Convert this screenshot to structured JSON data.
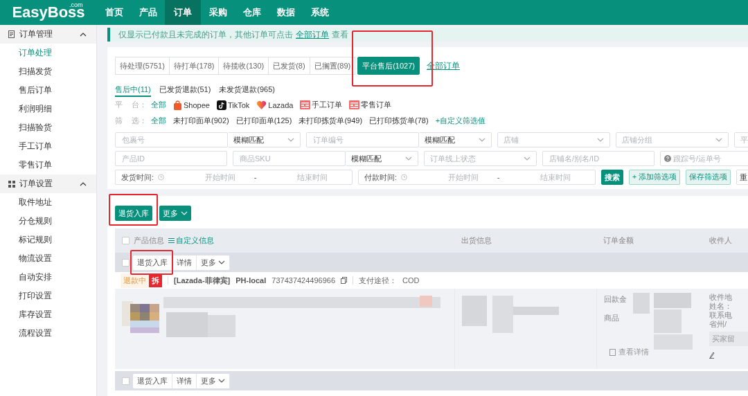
{
  "top_nav": {
    "logo": "EasyBoss",
    "logo_suffix": ".com",
    "items": [
      {
        "label": "首页",
        "selected": false
      },
      {
        "label": "产品",
        "selected": false
      },
      {
        "label": "订单",
        "selected": true
      },
      {
        "label": "采购",
        "selected": false
      },
      {
        "label": "仓库",
        "selected": false
      },
      {
        "label": "数据",
        "selected": false
      },
      {
        "label": "系统",
        "selected": false
      }
    ]
  },
  "sidebar": {
    "groups": [
      {
        "label": "订单管理",
        "kind": "doc",
        "expanded": true,
        "items": [
          {
            "label": "订单处理",
            "selected": true
          },
          {
            "label": "扫描发货",
            "selected": false
          },
          {
            "label": "售后订单",
            "selected": false
          },
          {
            "label": "利润明细",
            "selected": false
          },
          {
            "label": "扫描验货",
            "selected": false
          },
          {
            "label": "手工订单",
            "selected": false
          },
          {
            "label": "零售订单",
            "selected": false
          }
        ]
      },
      {
        "label": "订单设置",
        "kind": "grid",
        "expanded": true,
        "items": [
          {
            "label": "取件地址",
            "selected": false
          },
          {
            "label": "分仓规则",
            "selected": false
          },
          {
            "label": "标记规则",
            "selected": false
          },
          {
            "label": "物流设置",
            "selected": false
          },
          {
            "label": "自动安排",
            "selected": false
          },
          {
            "label": "打印设置",
            "selected": false
          },
          {
            "label": "库存设置",
            "selected": false
          },
          {
            "label": "流程设置",
            "selected": false
          }
        ]
      }
    ]
  },
  "notice": {
    "text": "仅显示已付款且未完成的订单，其他订单可点击",
    "link": "全部订单",
    "suffix": "查看"
  },
  "status_tabs": [
    {
      "label": "待处理(5751)",
      "selected": false,
      "highlighted": false
    },
    {
      "label": "待打单(178)",
      "selected": false,
      "highlighted": false
    },
    {
      "label": "待揽收(130)",
      "selected": false,
      "highlighted": false
    },
    {
      "label": "已发货(8)",
      "selected": false,
      "highlighted": false
    },
    {
      "label": "已搁置(89)",
      "selected": false,
      "highlighted": false
    },
    {
      "label": "平台售后(1027)",
      "selected": true,
      "highlighted": true
    }
  ],
  "all_orders_link": "全部订单",
  "sub_tabs": [
    {
      "label": "售后中(11)",
      "selected": true
    },
    {
      "label": "已发货退款(51)",
      "selected": false
    },
    {
      "label": "未发货退款(965)",
      "selected": false
    }
  ],
  "platform_filter": {
    "label": [
      "平",
      "台："
    ],
    "options": [
      {
        "label": "全部",
        "selected": true
      },
      {
        "label": "Shopee",
        "kind": "shopee",
        "selected": false
      },
      {
        "label": "TikTok",
        "kind": "tiktok",
        "selected": false
      },
      {
        "label": "Lazada",
        "kind": "lazada",
        "selected": false
      },
      {
        "label": "手工订单",
        "kind": "manual",
        "selected": false
      },
      {
        "label": "零售订单",
        "kind": "manual",
        "selected": false
      }
    ]
  },
  "print_filter": {
    "label": [
      "筛",
      "选："
    ],
    "options": [
      {
        "label": "全部",
        "selected": true
      },
      {
        "label": "未打印面单(902)",
        "selected": false
      },
      {
        "label": "已打印面单(125)",
        "selected": false
      },
      {
        "label": "未打印拣货单(949)",
        "selected": false
      },
      {
        "label": "已打印拣货单(78)",
        "selected": false
      }
    ],
    "custom_link": "+自定义筛选值"
  },
  "search_rows": [
    [
      {
        "kind": "combo",
        "placeholder": "包裹号",
        "value": "模糊匹配"
      },
      {
        "kind": "combo",
        "placeholder": "订单编号",
        "value": "模糊匹配"
      },
      {
        "kind": "select",
        "placeholder": "店铺"
      },
      {
        "kind": "select",
        "placeholder": "店铺分组"
      },
      {
        "kind": "edge-select",
        "placeholder": "平"
      }
    ],
    [
      {
        "kind": "input",
        "placeholder": "产品ID"
      },
      {
        "kind": "combo",
        "placeholder": "商品SKU",
        "value": "模糊匹配"
      },
      {
        "kind": "select",
        "placeholder": "订单线上状态"
      },
      {
        "kind": "input",
        "placeholder": "店铺名/别名/ID"
      },
      {
        "kind": "help-input",
        "placeholder": "跟踪号/运单号"
      }
    ],
    [
      {
        "kind": "daterange",
        "label": "发货时间:",
        "start": "开始时间",
        "separator": "-",
        "end": "结束时间"
      },
      {
        "kind": "daterange",
        "label": "付款时间:",
        "start": "开始时间",
        "separator": "-",
        "end": "结束时间"
      },
      {
        "kind": "primary",
        "label": "搜索"
      },
      {
        "kind": "light",
        "label": "+ 添加筛选项"
      },
      {
        "kind": "light",
        "label": "保存筛选项"
      },
      {
        "kind": "plain",
        "label": "重"
      }
    ]
  ],
  "bulk_actions": [
    {
      "label": "退货入库",
      "kind": "primary",
      "highlighted": true
    },
    {
      "label": "更多",
      "kind": "dropdown",
      "highlighted": false
    }
  ],
  "table": {
    "select_all_checked": false,
    "columns": [
      {
        "label": "产品信息"
      },
      {
        "label": "出货信息"
      },
      {
        "label": "订单金额"
      },
      {
        "label": "收件人"
      }
    ],
    "custom_info_link": "自定义信息",
    "orders": [
      {
        "checked": false,
        "actions": [
          {
            "label": "退货入库",
            "kind": "plain",
            "highlighted": true
          },
          {
            "label": "详情",
            "kind": "plain",
            "highlighted": false
          },
          {
            "label": "更多",
            "kind": "dropdown",
            "highlighted": false
          }
        ],
        "info": {
          "status_tag": "退款中",
          "split_tag": "拆",
          "store": "[Lazada-菲律宾]",
          "warehouse": "PH-local",
          "order_no": "737437424496966",
          "payment_label": "支付途径：",
          "payment": "COD",
          "amount_labels": [
            "回款金",
            "商品"
          ],
          "detail_link": "查看详情",
          "recipient_lines": [
            "收件地",
            "姓名：",
            "联系电",
            "省州/"
          ],
          "buyer_note": "买家留"
        }
      },
      {
        "checked": false,
        "actions": [
          {
            "label": "退货入库",
            "kind": "plain",
            "highlighted": false
          },
          {
            "label": "详情",
            "kind": "plain",
            "highlighted": false
          },
          {
            "label": "更多",
            "kind": "dropdown",
            "highlighted": false
          }
        ]
      }
    ]
  }
}
